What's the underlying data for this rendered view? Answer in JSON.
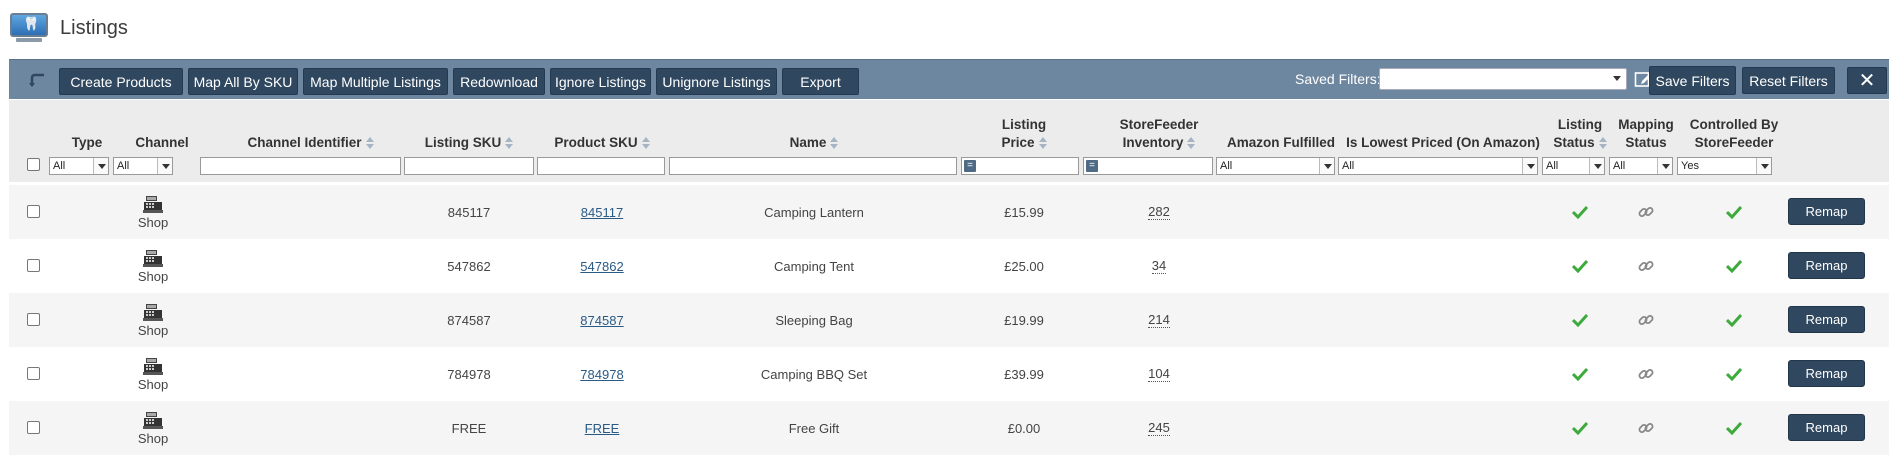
{
  "page": {
    "title": "Listings"
  },
  "toolbar": {
    "buttons": [
      "Create Products",
      "Map All By SKU",
      "Map Multiple Listings",
      "Redownload",
      "Ignore Listings",
      "Unignore Listings",
      "Export"
    ],
    "saved_filters_label": "Saved Filters:",
    "saved_filters_value": "",
    "save_filters": "Save Filters",
    "reset_filters": "Reset Filters",
    "close": "✕"
  },
  "columns": {
    "type": "Type",
    "channel": "Channel",
    "channel_identifier": "Channel Identifier",
    "listing_sku": "Listing SKU",
    "product_sku": "Product SKU",
    "name": "Name",
    "listing_price_1": "Listing",
    "listing_price_2": "Price",
    "storefeeder_inv_1": "StoreFeeder",
    "storefeeder_inv_2": "Inventory",
    "amazon_fulfilled": "Amazon Fulfilled",
    "lowest_priced": "Is Lowest Priced (On Amazon)",
    "listing_status_1": "Listing",
    "listing_status_2": "Status",
    "mapping_status_1": "Mapping",
    "mapping_status_2": "Status",
    "controlled_1": "Controlled By",
    "controlled_2": "StoreFeeder"
  },
  "filters": {
    "type": "All",
    "channel": "All",
    "amazon_fulfilled": "All",
    "lowest_priced": "All",
    "listing_status": "All",
    "mapping_status": "All",
    "controlled": "Yes",
    "price_eq": "=",
    "inv_eq": "="
  },
  "rows": [
    {
      "channel": "Shop",
      "listing_sku": "845117",
      "product_sku": "845117",
      "name": "Camping Lantern",
      "price": "£15.99",
      "inventory": "282",
      "action": "Remap"
    },
    {
      "channel": "Shop",
      "listing_sku": "547862",
      "product_sku": "547862",
      "name": "Camping Tent",
      "price": "£25.00",
      "inventory": "34",
      "action": "Remap"
    },
    {
      "channel": "Shop",
      "listing_sku": "874587",
      "product_sku": "874587",
      "name": "Sleeping Bag",
      "price": "£19.99",
      "inventory": "214",
      "action": "Remap"
    },
    {
      "channel": "Shop",
      "listing_sku": "784978",
      "product_sku": "784978",
      "name": "Camping BBQ Set",
      "price": "£39.99",
      "inventory": "104",
      "action": "Remap"
    },
    {
      "channel": "Shop",
      "listing_sku": "FREE",
      "product_sku": "FREE",
      "name": "Free Gift",
      "price": "£0.00",
      "inventory": "245",
      "action": "Remap"
    }
  ],
  "icons": {
    "logo": "monitor-tooth-icon",
    "back": "back-arrow-icon",
    "edit": "edit-icon",
    "shop": "cash-register-icon",
    "status": "checkmark-icon",
    "mapping": "chain-link-icon"
  },
  "colors": {
    "toolbar_bg": "#6e87a0",
    "button_bg": "#2f475f",
    "check": "#3cab3c",
    "link": "#2a5a86"
  }
}
